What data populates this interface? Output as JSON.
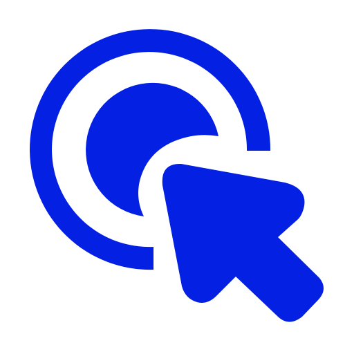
{
  "icon": {
    "name": "click-cursor-icon",
    "color": "#0421e3",
    "background": "#ffffff"
  }
}
